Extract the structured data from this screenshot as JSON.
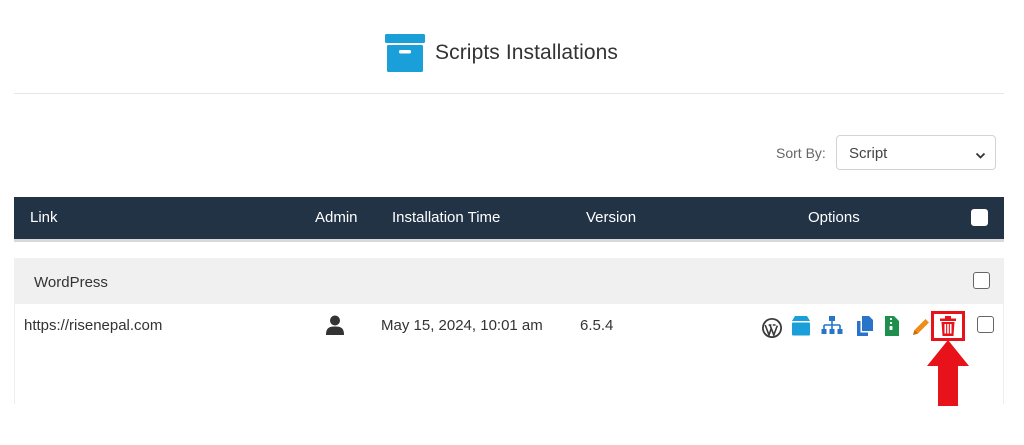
{
  "header": {
    "title": "Scripts Installations",
    "icon": "archive-box-icon"
  },
  "sort": {
    "label": "Sort By:",
    "selected": "Script"
  },
  "table": {
    "columns": [
      "Link",
      "Admin",
      "Installation Time",
      "Version",
      "Options"
    ],
    "group": {
      "label": "WordPress"
    },
    "rows": [
      {
        "link": "https://risenepal.com",
        "admin_icon": "user-icon",
        "installation_time": "May 15, 2024, 10:01 am",
        "version": "6.5.4",
        "options": [
          "wordpress-icon",
          "backup-box-icon",
          "sitemap-icon",
          "clone-icon",
          "zip-file-icon",
          "edit-pencil-icon",
          "trash-icon"
        ]
      }
    ]
  },
  "colors": {
    "header_bg": "#233346",
    "accent_blue": "#1a9fd9",
    "group_bg": "#f0f0f0",
    "delete_red": "#e8121b",
    "edit_orange": "#f08c1a",
    "zip_green": "#1f8f4e"
  }
}
